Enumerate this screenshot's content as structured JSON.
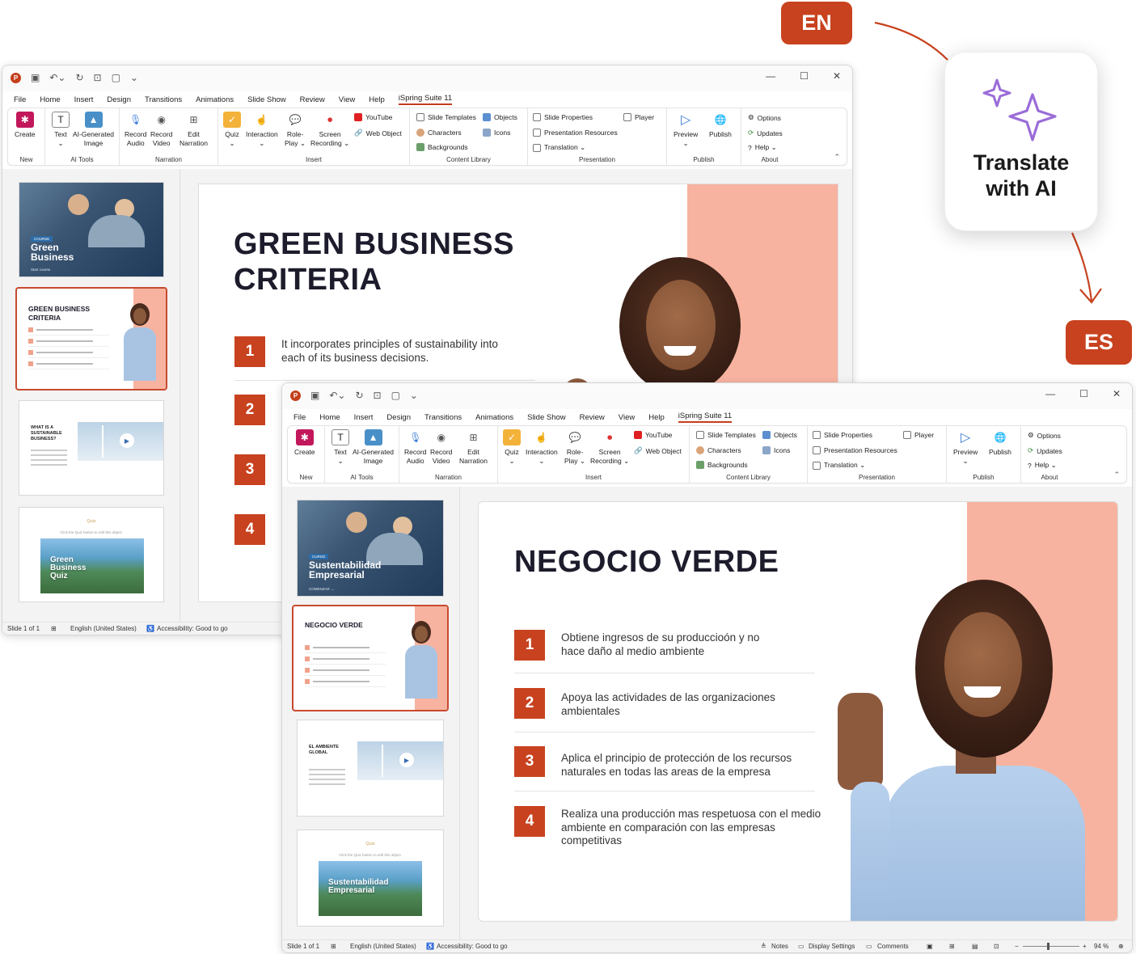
{
  "badges": {
    "source_lang": "EN",
    "target_lang": "ES"
  },
  "ai_card": {
    "line1": "Translate",
    "line2": "with AI",
    "icon": "sparkle-icon"
  },
  "menu": [
    "File",
    "Home",
    "Insert",
    "Design",
    "Transitions",
    "Animations",
    "Slide Show",
    "Review",
    "View",
    "Help",
    "iSpring Suite 11"
  ],
  "ribbon": {
    "create": "Create",
    "text": "Text",
    "ai_image": [
      "AI-Generated",
      "Image"
    ],
    "record_audio": [
      "Record",
      "Audio"
    ],
    "record_video": [
      "Record",
      "Video"
    ],
    "edit_narration": [
      "Edit",
      "Narration"
    ],
    "quiz": "Quiz",
    "interaction": "Interaction",
    "role_play": [
      "Role-",
      "Play ⌄"
    ],
    "screen_recording": [
      "Screen",
      "Recording ⌄"
    ],
    "youtube": "YouTube",
    "web_object": "Web Object",
    "slide_templates": "Slide Templates",
    "objects": "Objects",
    "characters": "Characters",
    "icons": "Icons",
    "backgrounds": "Backgrounds",
    "slide_properties": "Slide Properties",
    "player": "Player",
    "presentation_resources": "Presentation Resources",
    "translation": "Translation ⌄",
    "preview": "Preview",
    "publish": "Publish",
    "options": "Options",
    "updates": "Updates",
    "help": "Help ⌄",
    "groups": {
      "new": "New",
      "ai_tools": "AI Tools",
      "narration": "Narration",
      "insert": "Insert",
      "content_library": "Content Library",
      "presentation": "Presentation",
      "publish": "Publish",
      "about": "About"
    }
  },
  "status": {
    "slide": "Slide 1 of 1",
    "language": "English (United States)",
    "accessibility": "Accessibility: Good to go",
    "notes": "Notes",
    "display_settings": "Display Settings",
    "comments": "Comments",
    "zoom": "94 %"
  },
  "en": {
    "thumb1": {
      "tag": "COURSE",
      "title": "Green Business",
      "sub": "Start course"
    },
    "thumb2": {
      "title": "GREEN BUSINESS CRITERIA"
    },
    "thumb3": {
      "title": "WHAT IS A SUSTAINABLE BUSINESS?"
    },
    "thumb4": {
      "quiz": "Quiz",
      "hint": "Click the Quiz button to edit this object.",
      "img_title": "Green Business Quiz"
    },
    "slide": {
      "title_line1": "GREEN BUSINESS",
      "title_line2": "CRITERIA",
      "items": [
        {
          "n": "1",
          "text": "It incorporates principles of sustainability into each of its business decisions."
        },
        {
          "n": "2",
          "text": ""
        },
        {
          "n": "3",
          "text": ""
        },
        {
          "n": "4",
          "text": ""
        }
      ]
    }
  },
  "es": {
    "thumb1": {
      "tag": "CURSO",
      "title": "Sustentabilidad Empresarial",
      "sub": "COMENZAR →"
    },
    "thumb2": {
      "title": "NEGOCIO VERDE"
    },
    "thumb3": {
      "title": "EL AMBIENTE GLOBAL"
    },
    "thumb4": {
      "quiz": "Quiz",
      "hint": "Click the Quiz button to edit this object.",
      "img_title": "Sustentabilidad Empresarial"
    },
    "slide": {
      "title": "NEGOCIO VERDE",
      "items": [
        {
          "n": "1",
          "text": "Obtiene ingresos de su produccioón y no hace daño al medio ambiente"
        },
        {
          "n": "2",
          "text": "Apoya las actividades de las organizaciones ambientales"
        },
        {
          "n": "3",
          "text": "Aplica el principio de protección de los recursos naturales en todas las areas de la empresa"
        },
        {
          "n": "4",
          "text": "Realiza una producción mas respetuosa con el medio ambiente en comparación con las empresas competitivas"
        }
      ]
    }
  }
}
